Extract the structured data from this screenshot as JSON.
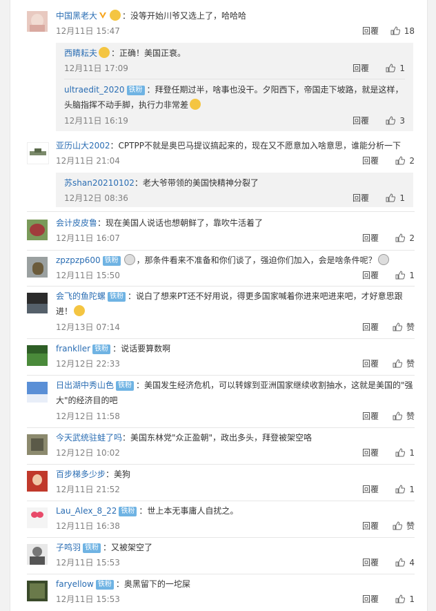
{
  "comments": [
    {
      "user": "中国黑老大",
      "text": "：没等开始川爷又选上了，哈哈哈",
      "time": "12月11日 15:47",
      "reply": "回覆",
      "likes": "18",
      "subs": [
        {
          "user": "西睛耘夫",
          "text": "：正确！美国正衰。",
          "time": "12月11日 17:09",
          "reply": "回覆",
          "likes": "1"
        },
        {
          "user": "ultraedit_2020",
          "badge": "铁粉",
          "text": "：拜登任期过半，啥事也没干。夕阳西下，帝国走下坡路，就是这样，头脑指挥不动手脚，执行力非常差",
          "time": "12月11日 16:19",
          "reply": "回覆",
          "likes": "3"
        }
      ]
    },
    {
      "user": "亚历山大2002",
      "text": "：CPTPP不就是奥巴马提议搞起来的，现在又不愿意加入啥意思，谁能分析一下",
      "time": "12月11日 21:04",
      "reply": "回覆",
      "likes": "2",
      "subs": [
        {
          "user": "苏shan20210102",
          "text": "：老大爷带领的美国快精神分裂了",
          "time": "12月12日 08:36",
          "reply": "回覆",
          "likes": "1"
        }
      ]
    },
    {
      "user": "会计皮皮鲁",
      "text": "：现在美国人说话也想朝鲜了，靠吹牛活着了",
      "time": "12月11日 16:07",
      "reply": "回覆",
      "likes": "2"
    },
    {
      "user": "zpzpzp600",
      "badge": "铁粉",
      "text": "，那条件看来不准备和你们谈了，强迫你们加入，会是啥条件呢？",
      "time": "12月11日 15:50",
      "reply": "回覆",
      "likes": "1"
    },
    {
      "user": "会飞的鱼陀螺",
      "badge": "铁粉",
      "text": "：说白了想来PT还不好用说，得更多国家喊着你进来吧进来吧，才好意思跟进！",
      "time": "12月13日 07:14",
      "reply": "回覆",
      "likes": "赞"
    },
    {
      "user": "frankller",
      "badge": "铁粉",
      "text": "：说话要算数啊",
      "time": "12月12日 22:33",
      "reply": "回覆",
      "likes": "赞"
    },
    {
      "user": "日出湖中秀山色",
      "badge": "铁粉",
      "text": "：美国发生经济危机，可以转嫁到亚洲国家继续收割抽水，这就是美国的\"强大\"的经济目的吧",
      "time": "12月12日 11:58",
      "reply": "回覆",
      "likes": "赞"
    },
    {
      "user": "今天武统驻蛙了吗",
      "text": "：美国东林党\"众正盈朝\"，政出多头，拜登被架空咯",
      "time": "12月12日 10:02",
      "reply": "回覆",
      "likes": "1"
    },
    {
      "user": "百步梯多少步",
      "text": "：美狗",
      "time": "12月11日 21:52",
      "reply": "回覆",
      "likes": "1"
    },
    {
      "user": "Lau_Alex_8_22",
      "badge": "铁粉",
      "text": "：世上本无事庸人自扰之。",
      "time": "12月11日 16:38",
      "reply": "回覆",
      "likes": "赞"
    },
    {
      "user": "子鸣羽",
      "badge": "铁粉",
      "text": "：又被架空了",
      "time": "12月11日 15:53",
      "reply": "回覆",
      "likes": "4"
    },
    {
      "user": "faryellow",
      "badge": "铁粉",
      "text": "：奥黑留下的一坨屎",
      "time": "12月11日 15:53",
      "reply": "回覆",
      "likes": "1"
    }
  ],
  "colors": {
    "link": "#2a6db3",
    "badge": "#6fb3e3",
    "subbg": "#f2f2f2",
    "meta": "#808080"
  },
  "icons": {
    "like": "thumbs-up-icon",
    "vip": "verified-v-icon",
    "emoji": "emoji-icon"
  }
}
